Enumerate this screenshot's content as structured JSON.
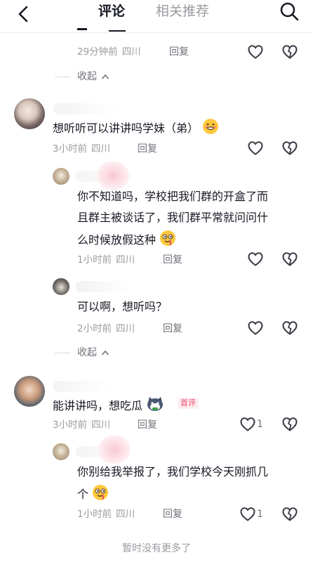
{
  "header": {
    "tab_comments": "评论",
    "tab_related": "相关推荐",
    "back_icon": "chevron-left-icon",
    "search_icon": "search-icon"
  },
  "colors": {
    "text": "#161823",
    "muted": "#9a9ba0",
    "badge": "#e84a6d"
  },
  "comments": [
    {
      "time": "29分钟前",
      "place": "四川",
      "reply": "回复"
    },
    {
      "text": "想听听可以讲讲吗学妹（弟）",
      "time": "3小时前",
      "place": "四川",
      "reply": "回复"
    },
    {
      "line1": "你不知道吗，学校把我们群的开盒了而",
      "line2": "且群主被谈话了，我们群平常就问问什",
      "line3": "么时候放假这种",
      "time": "1小时前",
      "place": "四川",
      "reply": "回复"
    },
    {
      "text": "可以啊，想听吗？",
      "time": "2小时前",
      "place": "四川",
      "reply": "回复"
    },
    {
      "text": "能讲讲吗，想吃瓜",
      "badge": "首评",
      "time": "3小时前",
      "place": "四川",
      "reply": "回复",
      "likes": "1"
    },
    {
      "line1": "你别给我举报了，我们学校今天刚抓几",
      "line2": "个",
      "time": "1小时前",
      "place": "四川",
      "reply": "回复",
      "likes": "1"
    }
  ],
  "collapse_label": "收起",
  "footer": "暂时没有更多了"
}
